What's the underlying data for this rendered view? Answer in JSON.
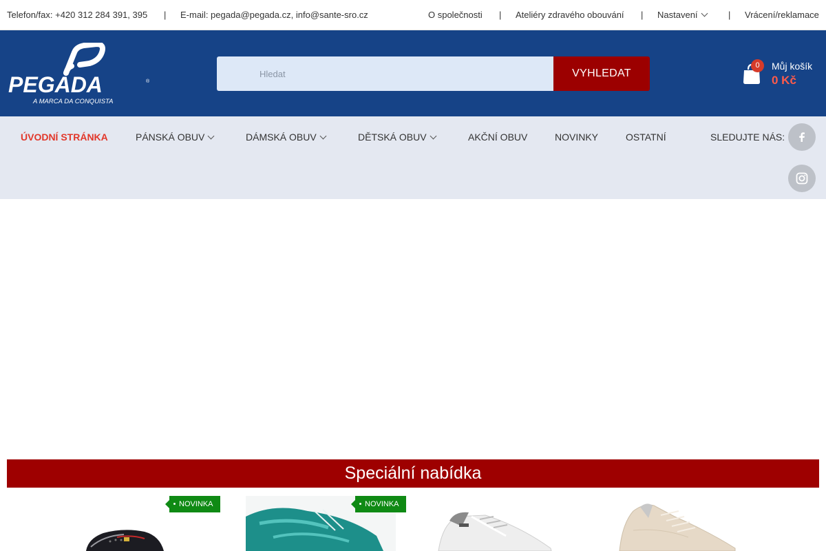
{
  "topbar": {
    "contact_phone": "Telefon/fax: +420 312 284 391, 395",
    "contact_email": "E-mail: pegada@pegada.cz, info@sante-sro.cz",
    "separator": "|",
    "links": {
      "about": "O společnosti",
      "ateliers": "Ateliéry zdravého obouvání",
      "settings": "Nastavení",
      "returns": "Vrácení/reklamace"
    }
  },
  "header": {
    "logo_text": "PEGADA",
    "logo_tagline": "A MARCA DA CONQUISTA",
    "search_placeholder": "Hledat",
    "search_button": "VYHLEDAT",
    "cart_count": "0",
    "cart_label": "Můj košík",
    "cart_total": "0 Kč"
  },
  "nav": {
    "items": [
      {
        "label": "ÚVODNÍ STRÁNKA",
        "active": true
      },
      {
        "label": "PÁNSKÁ OBUV"
      },
      {
        "label": "DÁMSKÁ OBUV"
      },
      {
        "label": "DĚTSKÁ OBUV"
      },
      {
        "label": "AKČNÍ OBUV"
      },
      {
        "label": "NOVINKY"
      },
      {
        "label": "OSTATNÍ"
      }
    ],
    "follow_label": "SLEDUJTE NÁS:",
    "social": [
      "facebook-icon",
      "instagram-icon"
    ]
  },
  "offer": {
    "title": "Speciální nabídka",
    "badge": "NOVINKA"
  },
  "colors": {
    "header_blue": "#164387",
    "accent_red": "#9c0000",
    "active_nav": "#e2372a",
    "badge_green": "#0f8a14",
    "nav_bg": "#e4e8f1"
  }
}
